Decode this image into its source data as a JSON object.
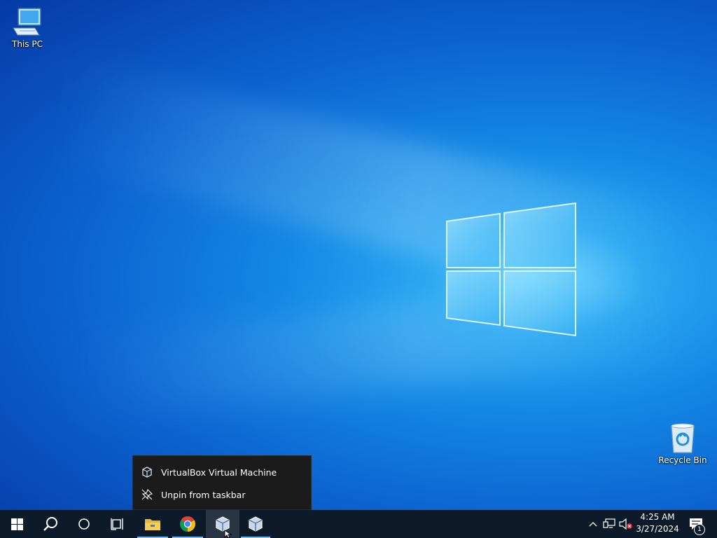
{
  "desktop": {
    "icons": [
      {
        "label": "This PC",
        "icon": "computer-icon"
      },
      {
        "label": "Recycle Bin",
        "icon": "recycle-bin-icon"
      }
    ]
  },
  "context_menu": {
    "items": [
      {
        "label": "VirtualBox Virtual Machine",
        "icon": "virtualbox-icon"
      },
      {
        "label": "Unpin from taskbar",
        "icon": "unpin-icon"
      }
    ]
  },
  "taskbar": {
    "buttons": [
      {
        "name": "start",
        "icon": "windows-start-icon"
      },
      {
        "name": "search",
        "icon": "search-icon"
      },
      {
        "name": "cortana",
        "icon": "cortana-icon"
      },
      {
        "name": "task-view",
        "icon": "task-view-icon"
      },
      {
        "name": "file-explorer",
        "icon": "folder-icon"
      },
      {
        "name": "chrome",
        "icon": "chrome-icon"
      },
      {
        "name": "virtualbox",
        "icon": "virtualbox-icon",
        "active": true
      },
      {
        "name": "virtualbox-2",
        "icon": "virtualbox-icon"
      }
    ],
    "tray": {
      "icons": [
        "chevron-up-icon",
        "network-icon",
        "volume-muted-icon"
      ],
      "time": "4:25 AM",
      "date": "3/27/2024",
      "notification_count": "1"
    }
  },
  "colors": {
    "taskbar": "#0c1a2a",
    "accent": "#76b9ed",
    "menu_bg": "#1b1b1b"
  }
}
